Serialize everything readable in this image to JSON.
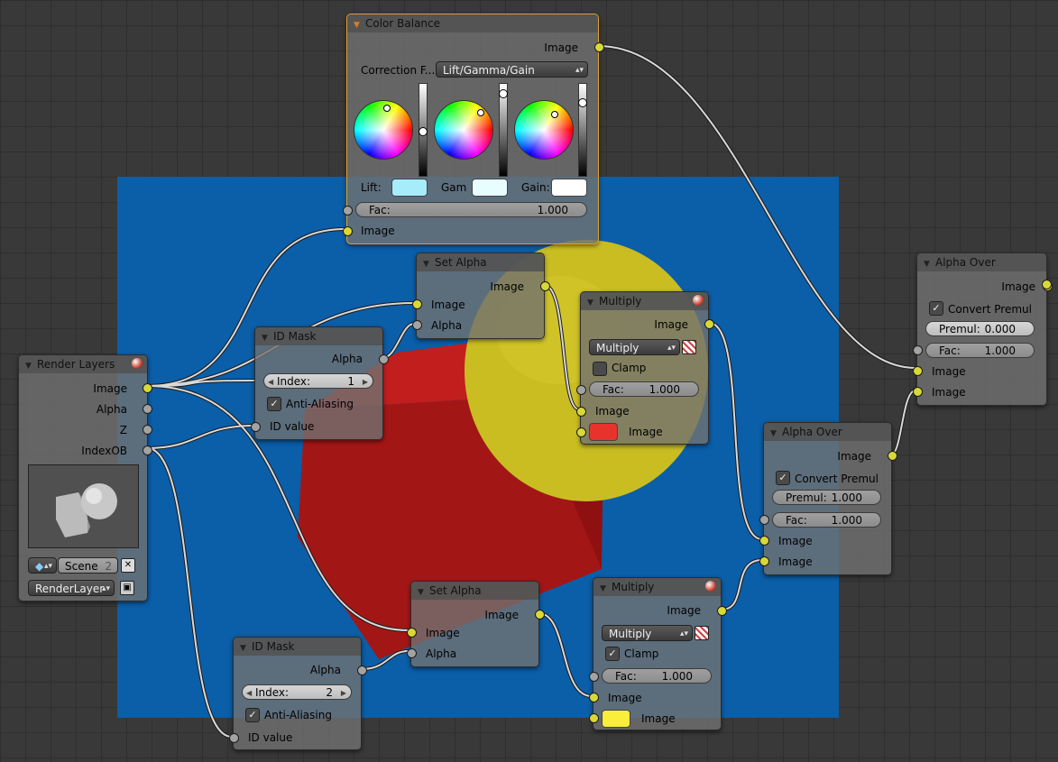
{
  "render_layers": {
    "title": "Render Layers",
    "outputs": [
      "Image",
      "Alpha",
      "Z",
      "IndexOB"
    ],
    "scene_label": "Scene",
    "scene_users": "2",
    "layer_label": "RenderLayer"
  },
  "id_mask_1": {
    "title": "ID Mask",
    "output": "Alpha",
    "index_label": "Index:",
    "index_value": "1",
    "aa_label": "Anti-Aliasing",
    "aa_checked": true,
    "input": "ID value"
  },
  "id_mask_2": {
    "title": "ID Mask",
    "output": "Alpha",
    "index_label": "Index:",
    "index_value": "2",
    "aa_label": "Anti-Aliasing",
    "aa_checked": true,
    "input": "ID value"
  },
  "color_balance": {
    "title": "Color Balance",
    "output": "Image",
    "correction_label": "Correction F...",
    "correction_value": "Lift/Gamma/Gain",
    "lift_label": "Lift:",
    "gamma_label": "Gam",
    "gain_label": "Gain:",
    "lift_color": "#a6ecfb",
    "gamma_color": "#e8fdff",
    "gain_color": "#ffffff",
    "fac_label": "Fac:",
    "fac_value": "1.000",
    "input": "Image"
  },
  "set_alpha_1": {
    "title": "Set Alpha",
    "output": "Image",
    "inputs": [
      "Image",
      "Alpha"
    ]
  },
  "set_alpha_2": {
    "title": "Set Alpha",
    "output": "Image",
    "inputs": [
      "Image",
      "Alpha"
    ]
  },
  "multiply_1": {
    "title": "Multiply",
    "output": "Image",
    "mode": "Multiply",
    "clamp_label": "Clamp",
    "clamp_checked": false,
    "fac_label": "Fac:",
    "fac_value": "1.000",
    "inputs": [
      "Image",
      "Image"
    ],
    "color": "#e8332c"
  },
  "multiply_2": {
    "title": "Multiply",
    "output": "Image",
    "mode": "Multiply",
    "clamp_label": "Clamp",
    "clamp_checked": true,
    "fac_label": "Fac:",
    "fac_value": "1.000",
    "inputs": [
      "Image",
      "Image"
    ],
    "color": "#f9ee3a"
  },
  "alpha_over_1": {
    "title": "Alpha Over",
    "output": "Image",
    "premul_label": "Convert Premul",
    "premul_checked": true,
    "premul_field_label": "Premul:",
    "premul_value": "0.000",
    "fac_label": "Fac:",
    "fac_value": "1.000",
    "inputs": [
      "Image",
      "Image"
    ]
  },
  "alpha_over_2": {
    "title": "Alpha Over",
    "output": "Image",
    "premul_label": "Convert Premul",
    "premul_checked": true,
    "premul_field_label": "Premul:",
    "premul_value": "1.000",
    "fac_label": "Fac:",
    "fac_value": "1.000",
    "inputs": [
      "Image",
      "Image"
    ]
  },
  "colors": {
    "backdrop": "#0b5ea8",
    "cube": "#b31c1c",
    "sphere": "#c9bd22",
    "socket_color": "#d8d838",
    "socket_value": "#a3a3a3",
    "wire": "#d9d9d9",
    "active_border": "#e0a030"
  }
}
